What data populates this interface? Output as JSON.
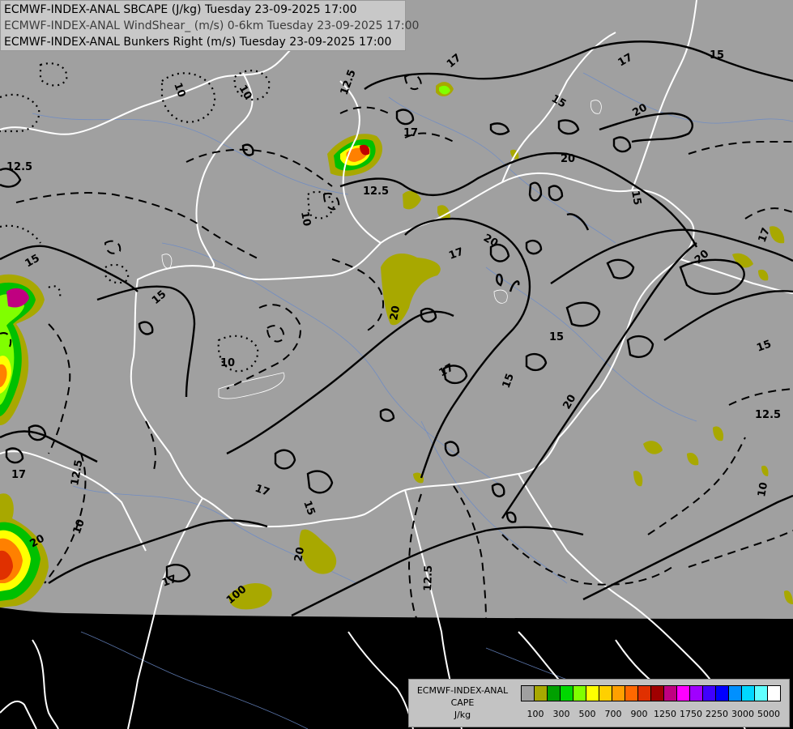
{
  "header": {
    "line1": "ECMWF-INDEX-ANAL SBCAPE (J/kg) Tuesday 23-09-2025 17:00",
    "line2": "ECMWF-INDEX-ANAL WindShear_ (m/s) 0-6km Tuesday 23-09-2025 17:00",
    "line3": "ECMWF-INDEX-ANAL Bunkers Right (m/s) Tuesday 23-09-2025 17:00"
  },
  "legend": {
    "line1": "ECMWF-INDEX-ANAL",
    "line2": "CAPE",
    "line3": "J/kg",
    "colors": [
      "#a0a0a0",
      "#a8a800",
      "#00a000",
      "#00d800",
      "#80ff00",
      "#ffff00",
      "#ffd000",
      "#ffa000",
      "#ff6800",
      "#e03000",
      "#a00000",
      "#c00080",
      "#ff00ff",
      "#a000ff",
      "#4000ff",
      "#0000ff",
      "#0090ff",
      "#00d8ff",
      "#60ffff",
      "#ffffff"
    ],
    "ticks": [
      "100",
      "300",
      "500",
      "700",
      "900",
      "1250",
      "1750",
      "2250",
      "3000",
      "5000"
    ]
  },
  "contour_labels": {
    "l_12_5": "12.5",
    "l_10": "10",
    "l_15": "15",
    "l_17": "17",
    "l_20": "20",
    "l_100": "100"
  }
}
